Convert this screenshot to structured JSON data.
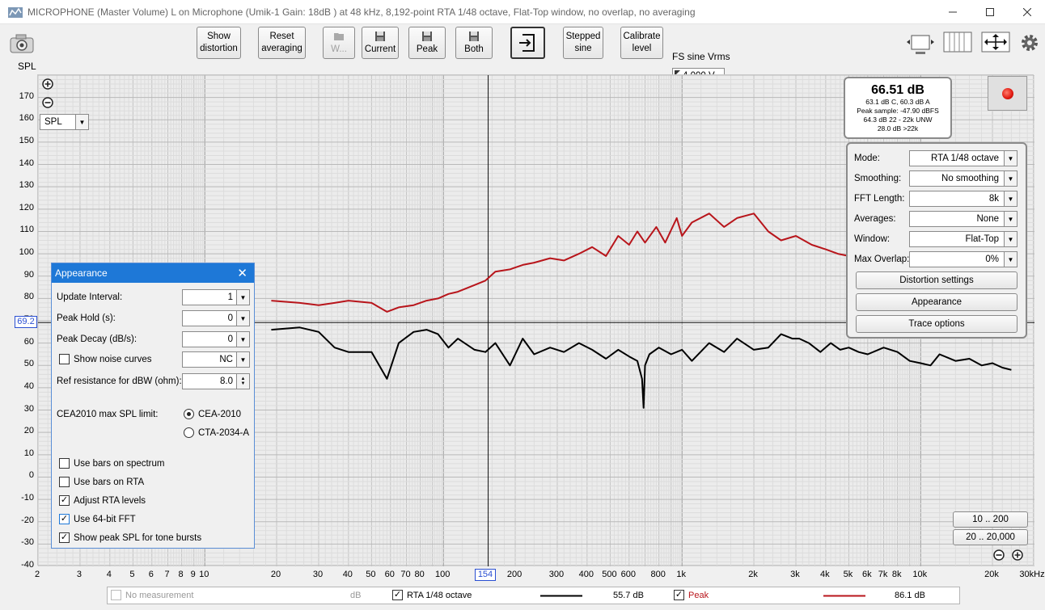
{
  "window": {
    "title": "MICROPHONE (Master Volume) L on Microphone (Umik-1  Gain: 18dB  ) at 48 kHz, 8,192-point RTA 1/48 octave, Flat-Top window, no overlap, no averaging"
  },
  "toolbar": {
    "show_distortion": [
      "Show",
      "distortion"
    ],
    "reset_averaging": [
      "Reset",
      "averaging"
    ],
    "w_label": "W...",
    "current_label": "Current",
    "peak_label": "Peak",
    "both_label": "Both",
    "stepped_sine": [
      "Stepped",
      "sine"
    ],
    "calibrate_level": [
      "Calibrate",
      "level"
    ],
    "fs_label": "FS sine Vrms",
    "fs_value": "4.000 V"
  },
  "plot": {
    "y_caption": "SPL",
    "unit_select": "SPL",
    "y_ticks": [
      "170",
      "160",
      "150",
      "140",
      "130",
      "120",
      "110",
      "100",
      "90",
      "80",
      "70",
      "60",
      "50",
      "40",
      "30",
      "20",
      "10",
      "0",
      "-10",
      "-20",
      "-30",
      "-40"
    ],
    "x_ticks": [
      "2",
      "3",
      "4",
      "5",
      "6",
      "7",
      "8",
      "9",
      "10",
      "20",
      "30",
      "40",
      "50",
      "60",
      "70",
      "80",
      "100",
      "200",
      "300",
      "400",
      "500",
      "600",
      "800",
      "1k",
      "2k",
      "3k",
      "4k",
      "5k",
      "6k",
      "7k",
      "8k",
      "10k",
      "20k",
      "30kHz"
    ],
    "y_marker": "69.2",
    "x_marker": "154",
    "range_1": "10 .. 200",
    "range_2": "20 .. 20,000",
    "colors": {
      "current": "#000000",
      "peak": "#b8151b",
      "marker": "#2a4fd2"
    }
  },
  "chart_data": {
    "type": "line",
    "title": "",
    "xlabel": "",
    "ylabel": "SPL",
    "x_scale": "log",
    "xlim": [
      2,
      30000
    ],
    "ylim": [
      -40,
      180
    ],
    "grid": true,
    "series": [
      {
        "name": "RTA 1/48 octave",
        "color": "#000000",
        "x": [
          19,
          25,
          30,
          35,
          40,
          50,
          58,
          65,
          75,
          85,
          95,
          105,
          115,
          135,
          150,
          165,
          190,
          215,
          240,
          280,
          320,
          370,
          420,
          480,
          540,
          600,
          650,
          680,
          690,
          700,
          730,
          800,
          900,
          1000,
          1100,
          1300,
          1500,
          1700,
          2000,
          2300,
          2600,
          2900,
          3100,
          3400,
          3800,
          4200,
          4600,
          5000,
          5500,
          6000,
          7000,
          8000,
          9000,
          10000,
          11000,
          12000,
          14000,
          16000,
          18000,
          20000,
          22000,
          24000
        ],
        "y": [
          66,
          67,
          65,
          58,
          56,
          56,
          44,
          60,
          65,
          66,
          64,
          58,
          62,
          57,
          56,
          60,
          50,
          62,
          55,
          58,
          56,
          60,
          57,
          53,
          57,
          54,
          52,
          44,
          31,
          50,
          55,
          58,
          55,
          57,
          52,
          60,
          56,
          62,
          57,
          58,
          64,
          62,
          62,
          60,
          56,
          60,
          57,
          58,
          56,
          55,
          58,
          56,
          52,
          51,
          50,
          55,
          52,
          53,
          50,
          51,
          49,
          48
        ]
      },
      {
        "name": "Peak",
        "color": "#b8151b",
        "x": [
          19,
          25,
          30,
          35,
          40,
          50,
          58,
          65,
          75,
          85,
          95,
          105,
          115,
          135,
          150,
          165,
          190,
          215,
          240,
          280,
          320,
          370,
          420,
          480,
          540,
          600,
          650,
          700,
          780,
          850,
          950,
          1000,
          1100,
          1300,
          1500,
          1700,
          2000,
          2300,
          2600,
          3000,
          3500,
          4000,
          4500,
          5000,
          5500,
          6000,
          7000,
          8000,
          9000,
          10000,
          11000,
          12000,
          14000,
          16000,
          18000,
          20000,
          22000,
          24000
        ],
        "y": [
          79,
          78,
          77,
          78,
          79,
          78,
          74,
          76,
          77,
          79,
          80,
          82,
          83,
          86,
          88,
          92,
          93,
          95,
          96,
          98,
          97,
          100,
          103,
          99,
          108,
          104,
          110,
          105,
          112,
          105,
          116,
          108,
          114,
          118,
          112,
          116,
          118,
          110,
          106,
          108,
          104,
          102,
          100,
          99,
          100,
          97,
          95,
          96,
          94,
          93,
          92,
          94,
          90,
          91,
          89,
          90,
          88,
          87
        ]
      }
    ]
  },
  "readout": {
    "main": "66.51 dB",
    "line1": "63.1 dB C, 60.3 dB A",
    "line2": "Peak sample: -47.90 dBFS",
    "line3": "64.3 dB 22 - 22k UNW",
    "line4": "28.0 dB >22k"
  },
  "rta_panel": {
    "mode_label": "Mode:",
    "mode_value": "RTA 1/48 octave",
    "smoothing_label": "Smoothing:",
    "smoothing_value": "No  smoothing",
    "fft_label": "FFT Length:",
    "fft_value": "8k",
    "averages_label": "Averages:",
    "averages_value": "None",
    "window_label": "Window:",
    "window_value": "Flat-Top",
    "overlap_label": "Max Overlap:",
    "overlap_value": "0%",
    "distortion_settings": "Distortion settings",
    "appearance": "Appearance",
    "trace_options": "Trace options"
  },
  "appearance": {
    "title": "Appearance",
    "update_interval_label": "Update Interval:",
    "update_interval": "1",
    "peak_hold_label": "Peak Hold (s):",
    "peak_hold": "0",
    "peak_decay_label": "Peak Decay (dB/s):",
    "peak_decay": "0",
    "noise_curves_label": "Show noise curves",
    "noise_curves_value": "NC",
    "ref_resistance_label": "Ref resistance for dBW (ohm):",
    "ref_resistance": "8.0",
    "cea_label": "CEA2010 max SPL limit:",
    "cea_option1": "CEA-2010",
    "cea_option2": "CTA-2034-A",
    "bars_spectrum": "Use bars on spectrum",
    "bars_rta": "Use bars on RTA",
    "adjust_rta": "Adjust RTA levels",
    "fft64": "Use 64-bit FFT",
    "peak_spl": "Show peak SPL for tone bursts"
  },
  "legend": {
    "no_measurement": "No measurement",
    "no_measurement_unit": "dB",
    "rta_label": "RTA 1/48 octave",
    "rta_value": "55.7 dB",
    "peak_label": "Peak",
    "peak_value": "86.1 dB"
  }
}
